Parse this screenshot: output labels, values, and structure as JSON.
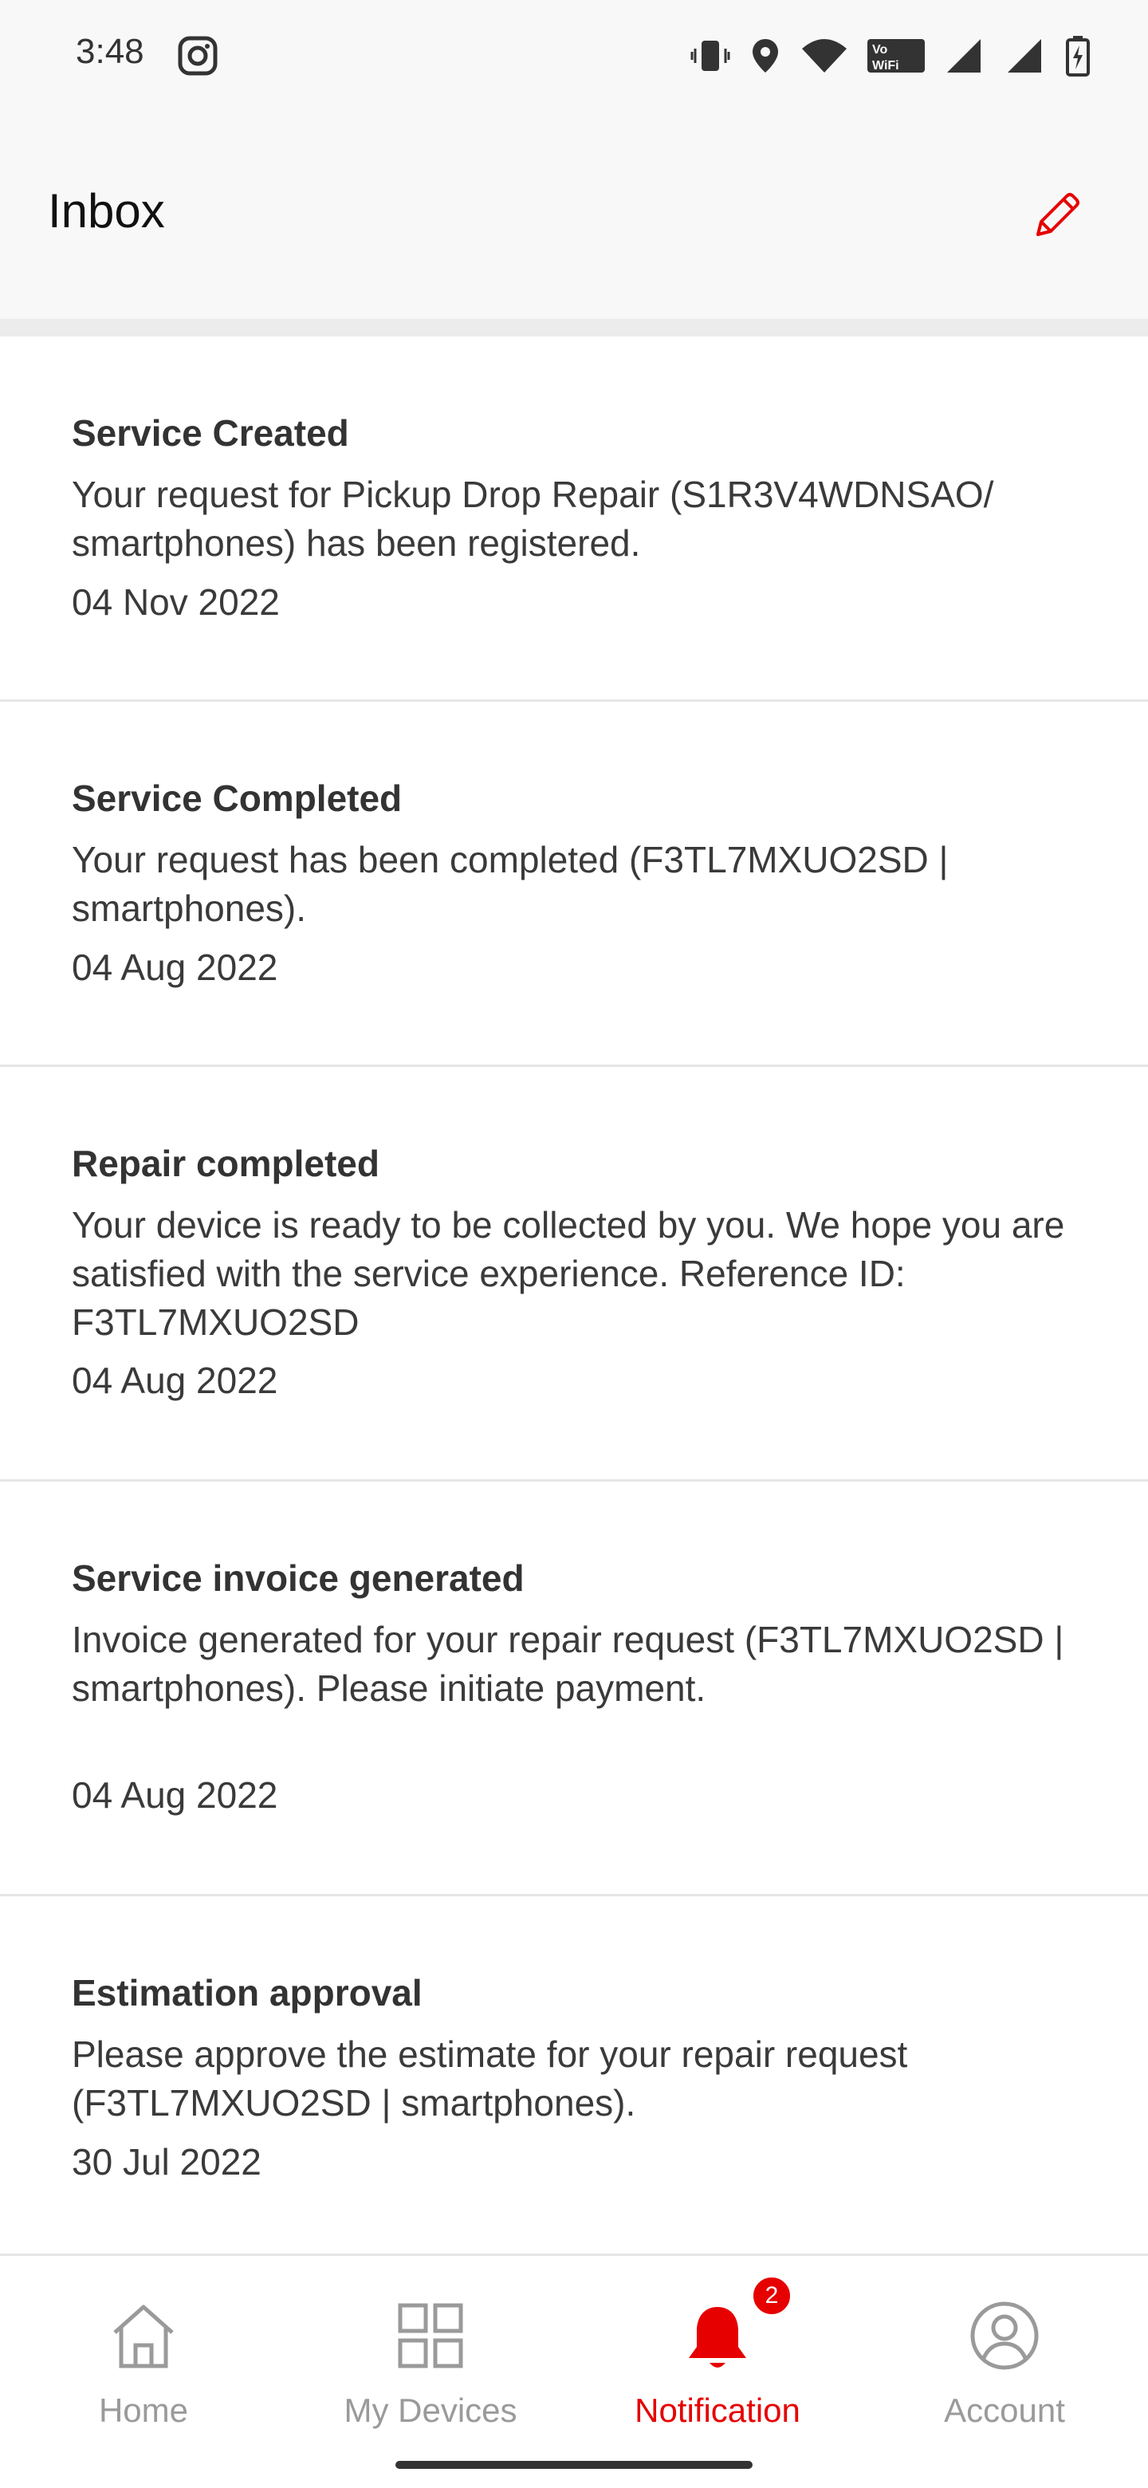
{
  "status_bar": {
    "time": "3:48"
  },
  "header": {
    "title": "Inbox",
    "edit_icon": "pencil-icon"
  },
  "notifications": [
    {
      "title": "Service Created",
      "body": "Your request for Pickup Drop Repair (S1R3V4WDNSAO/ smartphones) has been registered.",
      "date": "04 Nov 2022"
    },
    {
      "title": "Service Completed",
      "body": "Your request has been completed (F3TL7MXUO2SD | smartphones).",
      "date": "04 Aug 2022"
    },
    {
      "title": "Repair completed",
      "body": "Your device is ready to be collected by you. We hope you are satisfied with the service experience. Reference ID: F3TL7MXUO2SD",
      "date": "04 Aug 2022"
    },
    {
      "title": "Service invoice generated",
      "body": "Invoice generated for your repair request (F3TL7MXUO2SD | smartphones). Please initiate payment.",
      "date": "04 Aug 2022"
    },
    {
      "title": "Estimation approval",
      "body": "Please approve the estimate for your repair request (F3TL7MXUO2SD | smartphones).",
      "date": "30 Jul 2022"
    }
  ],
  "bottom_nav": {
    "items": [
      {
        "label": "Home",
        "icon": "home-icon"
      },
      {
        "label": "My Devices",
        "icon": "grid-icon"
      },
      {
        "label": "Notification",
        "icon": "bell-icon",
        "badge": "2",
        "active": true
      },
      {
        "label": "Account",
        "icon": "user-icon"
      }
    ]
  },
  "colors": {
    "accent": "#e60000",
    "inactive": "#9a9a9a"
  }
}
